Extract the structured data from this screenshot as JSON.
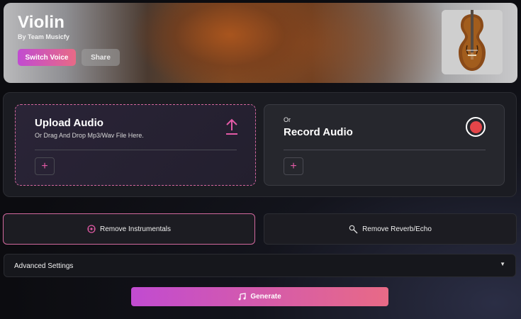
{
  "hero": {
    "title": "Violin",
    "subtitle": "By Team Musicfy",
    "switch_voice_label": "Switch Voice",
    "share_label": "Share",
    "thumbnail_icon": "violin-image"
  },
  "upload": {
    "title": "Upload Audio",
    "subtitle": "Or Drag And Drop Mp3/Wav File Here.",
    "plus": "+"
  },
  "record": {
    "prefix": "Or",
    "title": "Record Audio",
    "plus": "+"
  },
  "actions": {
    "remove_instrumentals": "Remove Instrumentals",
    "remove_reverb": "Remove Reverb/Echo"
  },
  "advanced": {
    "label": "Advanced Settings",
    "caret": "▼"
  },
  "generate": {
    "label": "Generate"
  },
  "colors": {
    "accent_start": "#c14bd1",
    "accent_end": "#e86a86",
    "record_red": "#e34549"
  }
}
